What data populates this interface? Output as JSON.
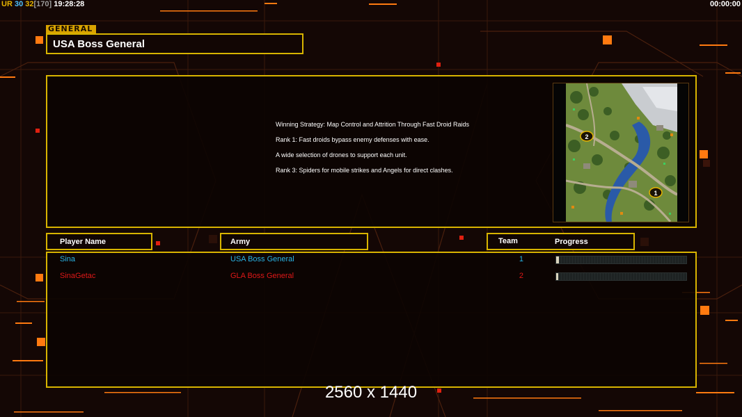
{
  "status_bar": {
    "ur_label": "UR",
    "value_a": "30",
    "value_b": "32",
    "value_c": "[170]",
    "clock": "19:28:28",
    "timer": "00:00:00"
  },
  "general": {
    "tag_label": "GENERAL",
    "name": "USA Boss General"
  },
  "briefing": {
    "lines": [
      "Winning Strategy: Map Control and Attrition Through Fast Droid Raids",
      "Rank 1: Fast droids bypass enemy defenses with ease.",
      "A wide selection of drones to support each unit.",
      "Rank 3: Spiders for mobile strikes and Angels for direct clashes."
    ]
  },
  "map": {
    "start_markers": [
      "2",
      "1"
    ]
  },
  "table": {
    "headers": {
      "player_name": "Player Name",
      "army": "Army",
      "team": "Team",
      "progress": "Progress"
    },
    "players": [
      {
        "name": "Sina",
        "army": "USA Boss General",
        "team": "1",
        "color": "#29b6e8",
        "progress": 0.02
      },
      {
        "name": "SinaGetac",
        "army": "GLA Boss General",
        "team": "2",
        "color": "#e01818",
        "progress": 0.01
      }
    ]
  },
  "resolution_label": "2560 x 1440",
  "colors": {
    "frame_yellow": "#d8b400",
    "accent_orange": "#ff7a10",
    "background": "#140705"
  }
}
